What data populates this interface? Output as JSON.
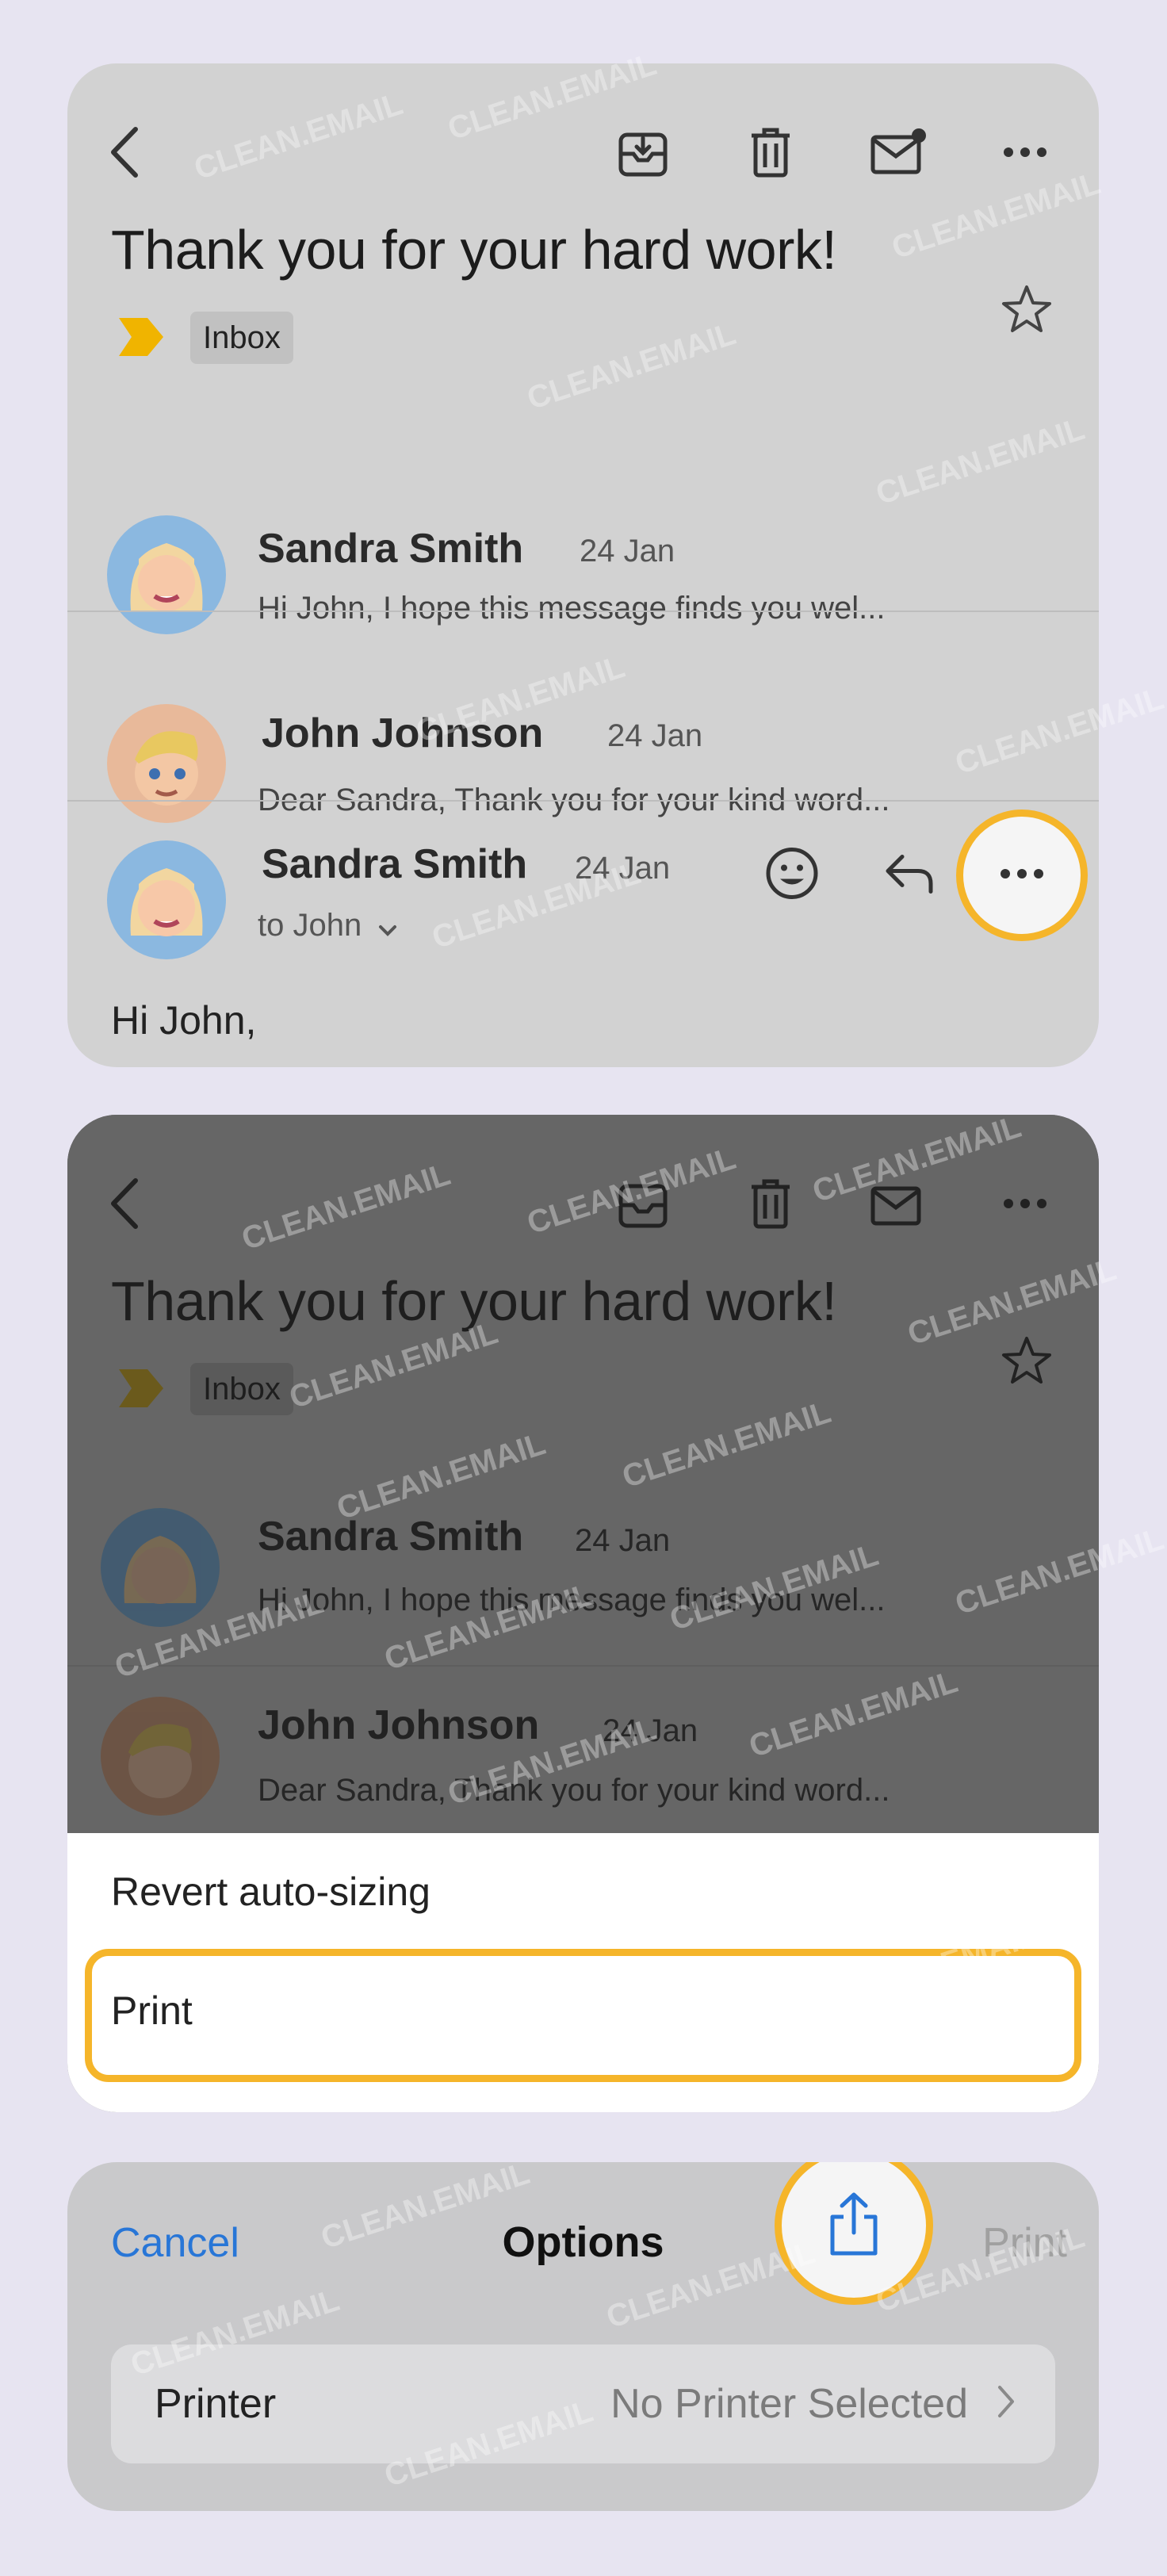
{
  "panel1": {
    "subject": "Thank you for your hard work!",
    "label": "Inbox",
    "messages": [
      {
        "sender": "Sandra Smith",
        "date": "24 Jan",
        "snippet": "Hi John, I hope this message finds you wel..."
      },
      {
        "sender": "John Johnson",
        "date": "24 Jan",
        "snippet": "Dear Sandra, Thank you for your kind word..."
      }
    ],
    "open_message": {
      "sender": "Sandra Smith",
      "date": "24 Jan",
      "recipient": "to John"
    },
    "body": "Hi John,"
  },
  "panel2": {
    "subject": "Thank you for your hard work!",
    "label": "Inbox",
    "messages": [
      {
        "sender": "Sandra Smith",
        "date": "24 Jan",
        "snippet": "Hi John, I hope this message finds you wel..."
      },
      {
        "sender": "John Johnson",
        "date": "24 Jan",
        "snippet": "Dear Sandra, Thank you for your kind word..."
      }
    ],
    "menu": [
      "Revert auto-sizing",
      "Print"
    ]
  },
  "panel3": {
    "cancel": "Cancel",
    "title": "Options",
    "print": "Print",
    "printer_label": "Printer",
    "printer_value": "No Printer Selected"
  },
  "watermark": "CLEAN.EMAIL",
  "colors": {
    "highlight": "#f5b52a",
    "link": "#2876d7",
    "label_chevron": "#f0b400"
  }
}
